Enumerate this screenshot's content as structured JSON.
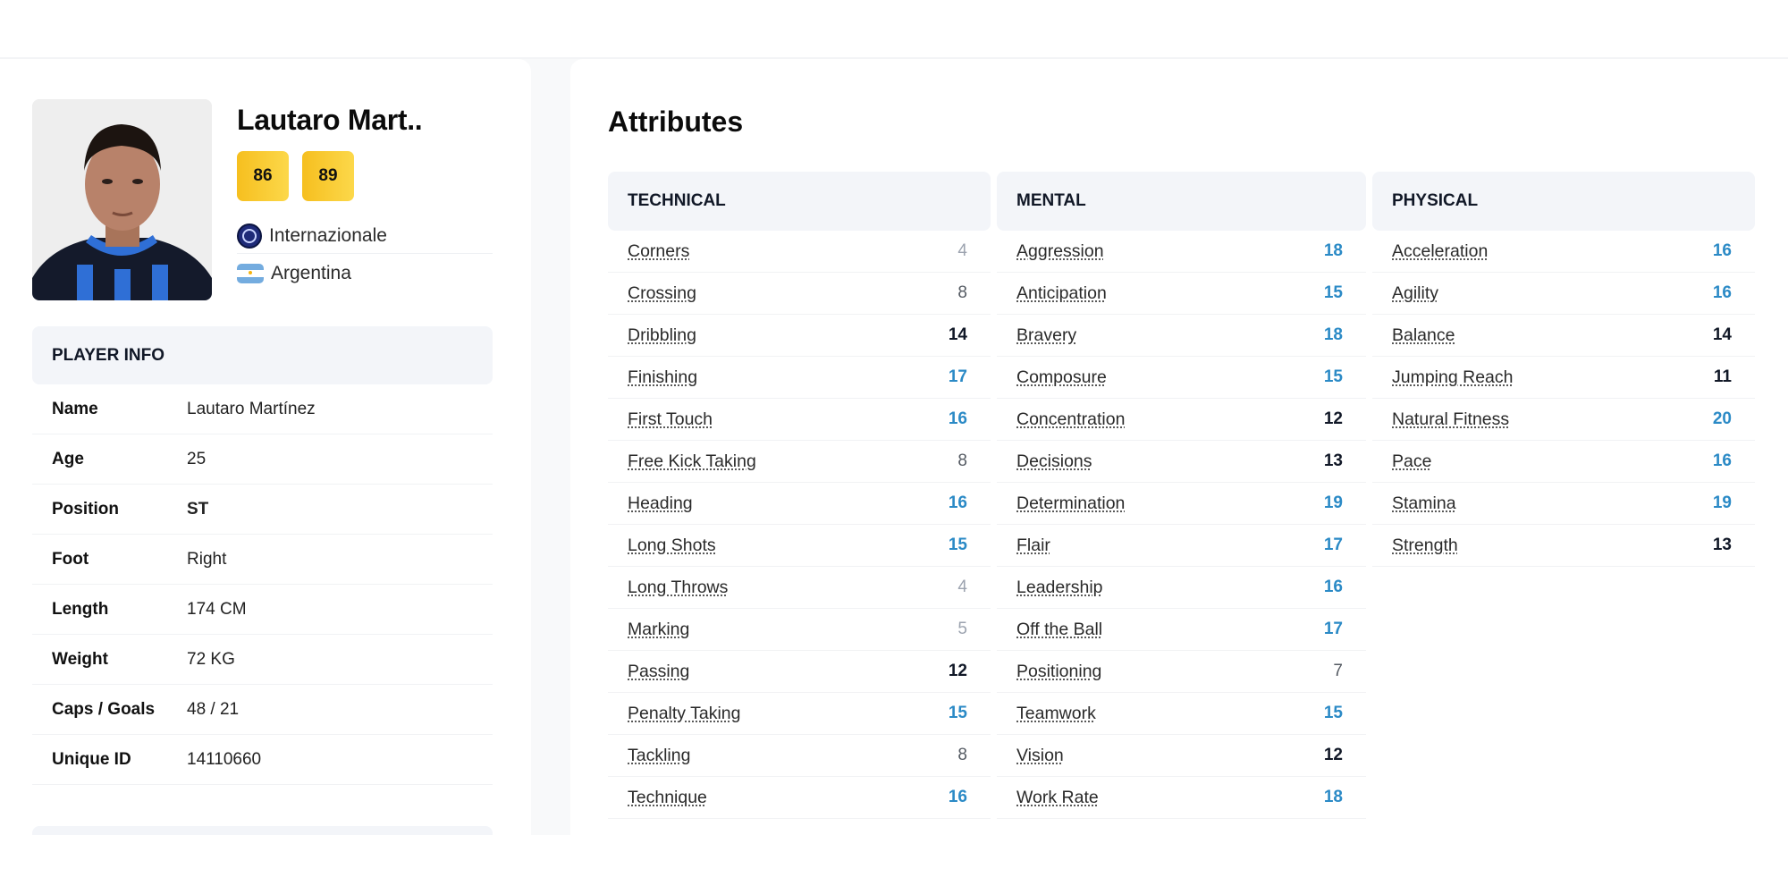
{
  "player": {
    "display_name": "Lautaro Mart..",
    "ratings": {
      "current": "86",
      "potential": "89"
    },
    "club": {
      "name": "Internazionale",
      "icon": "club-crest-icon"
    },
    "country": {
      "name": "Argentina",
      "icon": "flag-argentina-icon"
    }
  },
  "player_info": {
    "title": "PLAYER INFO",
    "rows": [
      {
        "label": "Name",
        "value": "Lautaro Martínez"
      },
      {
        "label": "Age",
        "value": "25"
      },
      {
        "label": "Position",
        "value": "ST"
      },
      {
        "label": "Foot",
        "value": "Right"
      },
      {
        "label": "Length",
        "value": "174 CM"
      },
      {
        "label": "Weight",
        "value": "72 KG"
      },
      {
        "label": "Caps / Goals",
        "value": "48 / 21"
      },
      {
        "label": "Unique ID",
        "value": "14110660"
      }
    ]
  },
  "attributes": {
    "title": "Attributes",
    "value_colors": {
      "low": "#9ca3af",
      "mid": "#555b63",
      "good": "#111827",
      "high": "#2b8ac6"
    },
    "badge_color": "#f6bf1f",
    "columns": [
      {
        "title": "TECHNICAL",
        "items": [
          {
            "name": "Corners",
            "value": 4
          },
          {
            "name": "Crossing",
            "value": 8
          },
          {
            "name": "Dribbling",
            "value": 14
          },
          {
            "name": "Finishing",
            "value": 17
          },
          {
            "name": "First Touch",
            "value": 16
          },
          {
            "name": "Free Kick Taking",
            "value": 8
          },
          {
            "name": "Heading",
            "value": 16
          },
          {
            "name": "Long Shots",
            "value": 15
          },
          {
            "name": "Long Throws",
            "value": 4
          },
          {
            "name": "Marking",
            "value": 5
          },
          {
            "name": "Passing",
            "value": 12
          },
          {
            "name": "Penalty Taking",
            "value": 15
          },
          {
            "name": "Tackling",
            "value": 8
          },
          {
            "name": "Technique",
            "value": 16
          }
        ]
      },
      {
        "title": "MENTAL",
        "items": [
          {
            "name": "Aggression",
            "value": 18
          },
          {
            "name": "Anticipation",
            "value": 15
          },
          {
            "name": "Bravery",
            "value": 18
          },
          {
            "name": "Composure",
            "value": 15
          },
          {
            "name": "Concentration",
            "value": 12
          },
          {
            "name": "Decisions",
            "value": 13
          },
          {
            "name": "Determination",
            "value": 19
          },
          {
            "name": "Flair",
            "value": 17
          },
          {
            "name": "Leadership",
            "value": 16
          },
          {
            "name": "Off the Ball",
            "value": 17
          },
          {
            "name": "Positioning",
            "value": 7
          },
          {
            "name": "Teamwork",
            "value": 15
          },
          {
            "name": "Vision",
            "value": 12
          },
          {
            "name": "Work Rate",
            "value": 18
          }
        ]
      },
      {
        "title": "PHYSICAL",
        "items": [
          {
            "name": "Acceleration",
            "value": 16
          },
          {
            "name": "Agility",
            "value": 16
          },
          {
            "name": "Balance",
            "value": 14
          },
          {
            "name": "Jumping Reach",
            "value": 11
          },
          {
            "name": "Natural Fitness",
            "value": 20
          },
          {
            "name": "Pace",
            "value": 16
          },
          {
            "name": "Stamina",
            "value": 19
          },
          {
            "name": "Strength",
            "value": 13
          }
        ]
      }
    ]
  }
}
